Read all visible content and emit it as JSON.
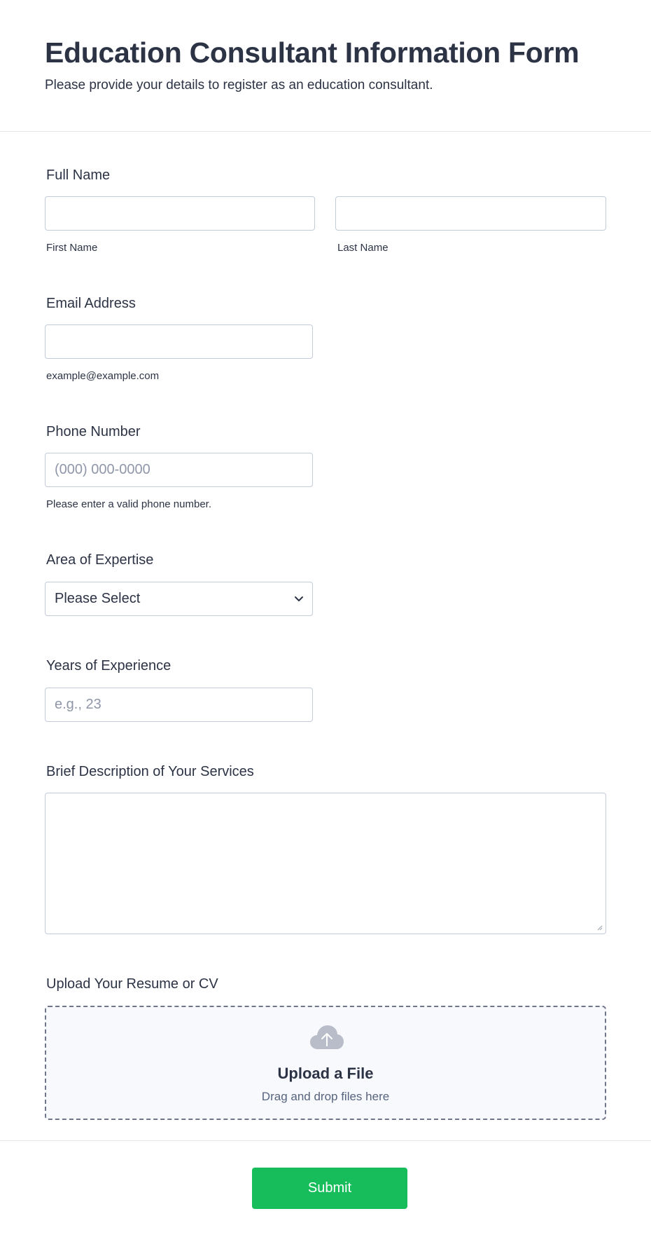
{
  "header": {
    "title": "Education Consultant Information Form",
    "subtitle": "Please provide your details to register as an education consultant."
  },
  "fields": {
    "full_name": {
      "label": "Full Name",
      "first_value": "",
      "last_value": "",
      "first_sublabel": "First Name",
      "last_sublabel": "Last Name"
    },
    "email": {
      "label": "Email Address",
      "value": "",
      "sublabel": "example@example.com"
    },
    "phone": {
      "label": "Phone Number",
      "value": "",
      "placeholder": "(000) 000-0000",
      "sublabel": "Please enter a valid phone number."
    },
    "expertise": {
      "label": "Area of Expertise",
      "selected": "Please Select"
    },
    "experience": {
      "label": "Years of Experience",
      "value": "",
      "placeholder": "e.g., 23"
    },
    "description": {
      "label": "Brief Description of Your Services",
      "value": ""
    },
    "resume": {
      "label": "Upload Your Resume or CV",
      "upload_title": "Upload a File",
      "upload_hint": "Drag and drop files here"
    }
  },
  "footer": {
    "submit_label": "Submit"
  },
  "colors": {
    "accent": "#18bd5b",
    "text": "#2c3345",
    "border": "#c3cad8",
    "icon": "#b8bdc9"
  },
  "icons": {
    "select": "chevron-down-icon",
    "upload": "cloud-upload-icon",
    "resize": "resize-grip-icon"
  }
}
